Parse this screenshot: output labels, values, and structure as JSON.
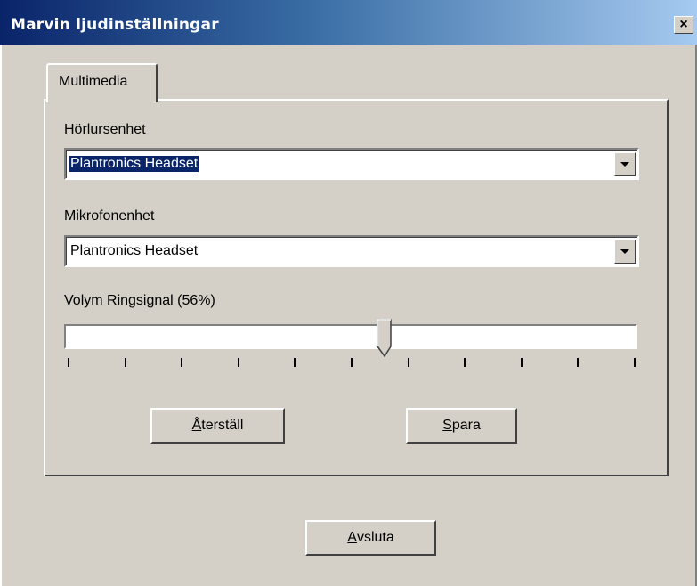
{
  "window": {
    "title": "Marvin ljudinställningar",
    "close_glyph": "×",
    "close_icon": "close-icon"
  },
  "tabs": [
    {
      "label": "Multimedia",
      "active": true
    }
  ],
  "headset": {
    "label": "Hörlursenhet",
    "value": "Plantronics Headset",
    "selected": true,
    "arrow_icon": "chevron-down-icon"
  },
  "microphone": {
    "label": "Mikrofonenhet",
    "value": "Plantronics Headset",
    "arrow_icon": "chevron-down-icon"
  },
  "volume": {
    "label": "Volym Ringsignal (56%)",
    "value_percent": 56,
    "tick_count": 11
  },
  "buttons": {
    "reset": {
      "mnemonic": "Å",
      "rest": "terställ"
    },
    "save": {
      "mnemonic": "S",
      "rest": "para"
    },
    "exit": {
      "mnemonic": "A",
      "rest": "vsluta"
    }
  },
  "colors": {
    "face": "#d4d0c8",
    "title_start": "#0a246a",
    "title_end": "#a6caf0",
    "selection": "#0a246a"
  }
}
